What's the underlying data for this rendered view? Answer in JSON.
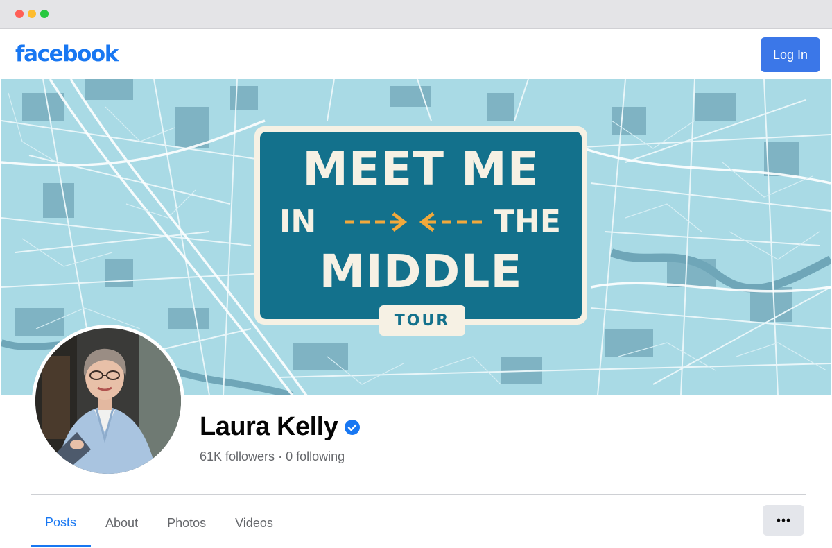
{
  "brand": {
    "logo_text": "facebook",
    "color": "#1877f2"
  },
  "header": {
    "login_label": "Log In"
  },
  "cover": {
    "line1": "MEET ME",
    "line2_left": "IN",
    "line2_right": "THE",
    "line3": "MIDDLE",
    "badge": "TOUR",
    "map_color": "#a9dae5",
    "card_color": "#13718c",
    "arrow_color": "#f2a93b"
  },
  "profile": {
    "name": "Laura Kelly",
    "verified": true,
    "followers": "61K followers",
    "separator": " · ",
    "following": "0 following"
  },
  "tabs": [
    {
      "label": "Posts",
      "active": true
    },
    {
      "label": "About",
      "active": false
    },
    {
      "label": "Photos",
      "active": false
    },
    {
      "label": "Videos",
      "active": false
    }
  ],
  "more_icon": "more-dots-icon"
}
